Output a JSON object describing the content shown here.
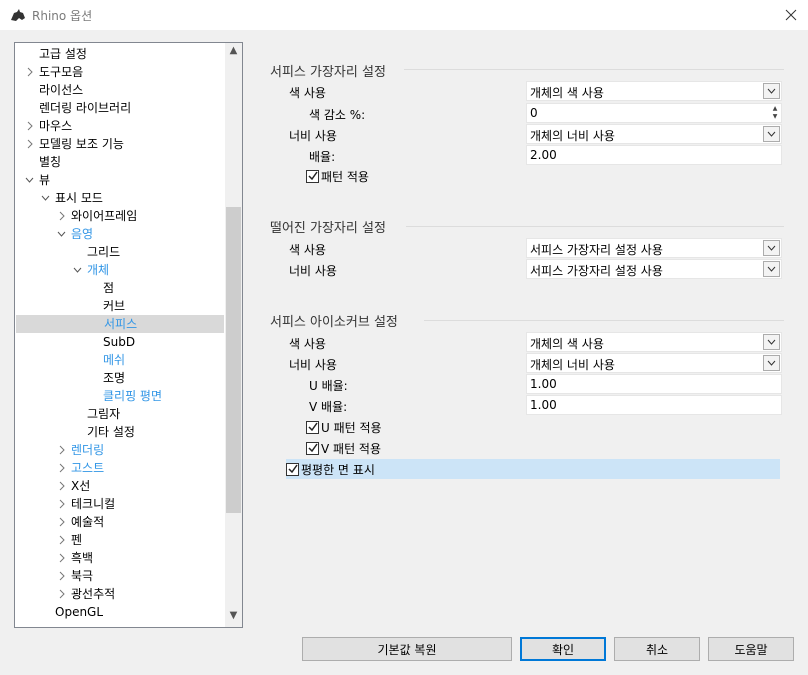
{
  "window": {
    "title": "Rhino 옵션",
    "app_icon": "rhino-icon",
    "close_icon": "close-icon"
  },
  "tree": {
    "items": [
      {
        "label": "고급 설정",
        "arrow": "",
        "indent": 0
      },
      {
        "label": "도구모음",
        "arrow": ">",
        "indent": 0
      },
      {
        "label": "라이선스",
        "arrow": "",
        "indent": 0
      },
      {
        "label": "렌더링 라이브러리",
        "arrow": "",
        "indent": 0
      },
      {
        "label": "마우스",
        "arrow": ">",
        "indent": 0
      },
      {
        "label": "모델링 보조 기능",
        "arrow": ">",
        "indent": 0
      },
      {
        "label": "별칭",
        "arrow": "",
        "indent": 0
      },
      {
        "label": "뷰",
        "arrow": "v",
        "indent": 0
      },
      {
        "label": "표시 모드",
        "arrow": "v",
        "indent": 1
      },
      {
        "label": "와이어프레임",
        "arrow": ">",
        "indent": 2
      },
      {
        "label": "음영",
        "arrow": "v",
        "indent": 2,
        "blue": true
      },
      {
        "label": "그리드",
        "arrow": "",
        "indent": 3
      },
      {
        "label": "개체",
        "arrow": "v",
        "indent": 3,
        "blue": true
      },
      {
        "label": "점",
        "arrow": "",
        "indent": 4
      },
      {
        "label": "커브",
        "arrow": "",
        "indent": 4
      },
      {
        "label": "서피스",
        "arrow": "",
        "indent": 4,
        "blue": true,
        "selected": true
      },
      {
        "label": "SubD",
        "arrow": "",
        "indent": 4
      },
      {
        "label": "메쉬",
        "arrow": "",
        "indent": 4,
        "blue": true
      },
      {
        "label": "조명",
        "arrow": "",
        "indent": 4
      },
      {
        "label": "클리핑 평면",
        "arrow": "",
        "indent": 4,
        "blue": true
      },
      {
        "label": "그림자",
        "arrow": "",
        "indent": 3
      },
      {
        "label": "기타 설정",
        "arrow": "",
        "indent": 3
      },
      {
        "label": "렌더링",
        "arrow": ">",
        "indent": 2,
        "blue": true
      },
      {
        "label": "고스트",
        "arrow": ">",
        "indent": 2,
        "blue": true
      },
      {
        "label": "X선",
        "arrow": ">",
        "indent": 2
      },
      {
        "label": "테크니컬",
        "arrow": ">",
        "indent": 2
      },
      {
        "label": "예술적",
        "arrow": ">",
        "indent": 2
      },
      {
        "label": "펜",
        "arrow": ">",
        "indent": 2
      },
      {
        "label": "흑백",
        "arrow": ">",
        "indent": 2
      },
      {
        "label": "북극",
        "arrow": ">",
        "indent": 2
      },
      {
        "label": "광선추적",
        "arrow": ">",
        "indent": 2
      },
      {
        "label": "OpenGL",
        "arrow": "",
        "indent": 1
      }
    ]
  },
  "surface_edge": {
    "title": "서피스 가장자리 설정",
    "color_usage_label": "색 사용",
    "color_usage_value": "개체의 색 사용",
    "color_reduction_label": "색 감소 %:",
    "color_reduction_value": "0",
    "width_usage_label": "너비 사용",
    "width_usage_value": "개체의 너비 사용",
    "scale_label": "배율:",
    "scale_value": "2.00",
    "apply_pattern_label": "패턴 적용",
    "apply_pattern_checked": true
  },
  "naked_edge": {
    "title": "떨어진 가장자리 설정",
    "color_usage_label": "색 사용",
    "color_usage_value": "서피스 가장자리 설정 사용",
    "width_usage_label": "너비 사용",
    "width_usage_value": "서피스 가장자리 설정 사용"
  },
  "isocurve": {
    "title": "서피스 아이소커브 설정",
    "color_usage_label": "색 사용",
    "color_usage_value": "개체의 색 사용",
    "width_usage_label": "너비 사용",
    "width_usage_value": "개체의 너비 사용",
    "u_scale_label": "U 배율:",
    "u_scale_value": "1.00",
    "v_scale_label": "V 배율:",
    "v_scale_value": "1.00",
    "u_pattern_label": "U 패턴 적용",
    "v_pattern_label": "V 패턴 적용",
    "flat_faces_label": "평평한 면 표시"
  },
  "buttons": {
    "restore_defaults": "기본값 복원",
    "ok": "확인",
    "cancel": "취소",
    "help": "도움말"
  },
  "colors": {
    "accent_blue": "#3296e6",
    "selection": "#d9d9d9",
    "highlight": "#cce4f7"
  }
}
